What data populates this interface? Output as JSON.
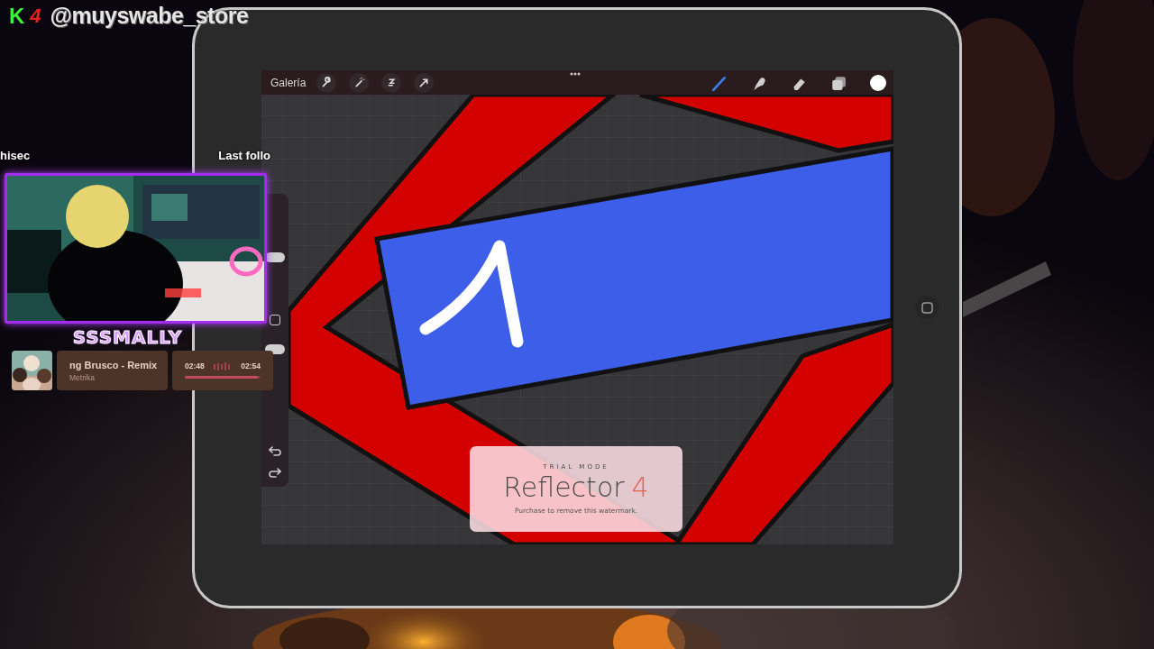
{
  "channel_banner": {
    "badge_letter": "K",
    "badge_number": "4",
    "handle": "@muyswabe_store"
  },
  "stream_labels": [
    {
      "text": "hisec"
    },
    {
      "text": "Last follo"
    }
  ],
  "webcam": {
    "kind": "picture",
    "name_plate": "SSSMALLY"
  },
  "now_playing": {
    "title": "ng Brusco - Remix",
    "artist": "Metrika",
    "elapsed": "02:48",
    "total": "02:54",
    "level": 0.97
  },
  "tablet": {
    "toolbar": {
      "gallery": "Galería",
      "left_tools": [
        {
          "kind": "wrench"
        },
        {
          "kind": "wand"
        },
        {
          "kind": "selection"
        },
        {
          "kind": "transform"
        }
      ],
      "right_tools": [
        {
          "kind": "brush",
          "selected": true
        },
        {
          "kind": "smudge",
          "selected": false
        },
        {
          "kind": "eraser",
          "selected": false
        },
        {
          "kind": "layers",
          "selected": false
        }
      ]
    },
    "sidebar": {
      "sliders": [
        {
          "level": 0.45
        },
        {
          "level": 0.85
        }
      ]
    }
  },
  "watermark_card": {
    "mode": "TRIAL MODE",
    "product": "Reflector",
    "version": "4",
    "note": "Purchase to remove this watermark."
  }
}
